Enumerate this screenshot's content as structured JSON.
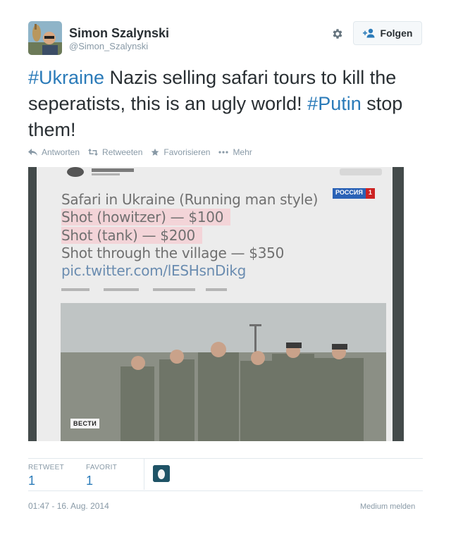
{
  "user": {
    "name": "Simon Szalynski",
    "handle": "@Simon_Szalynski"
  },
  "header": {
    "follow_label": "Folgen"
  },
  "tweet": {
    "segments": [
      {
        "text": "#Ukraine",
        "hashtag": true
      },
      {
        "text": " Nazis selling safari tours to kill the seperatists, this is an ugly world! ",
        "hashtag": false
      },
      {
        "text": "#Putin",
        "hashtag": true
      },
      {
        "text": " stop them!",
        "hashtag": false
      }
    ]
  },
  "actions": {
    "reply": "Antworten",
    "retweet": "Retweeten",
    "favorite": "Favorisieren",
    "more": "Mehr"
  },
  "media": {
    "lines": [
      "Safari in Ukraine (Running man style)",
      "Shot (howitzer) — $100",
      "Shot (tank) — $200",
      "Shot through the village — $350",
      "pic.twitter.com/lESHsnDikg"
    ],
    "channel_logo": "РОССИЯ",
    "channel_number": "1",
    "caption": "ВЕСТИ"
  },
  "stats": {
    "retweets_label": "RETWEET",
    "retweets": "1",
    "favorites_label": "FAVORIT",
    "favorites": "1"
  },
  "footer": {
    "timestamp": "01:47 - 16. Aug. 2014",
    "report": "Medium melden"
  },
  "colors": {
    "link": "#2b7bb9",
    "muted": "#8899a6",
    "text": "#292f33",
    "border": "#e1e8ed"
  }
}
